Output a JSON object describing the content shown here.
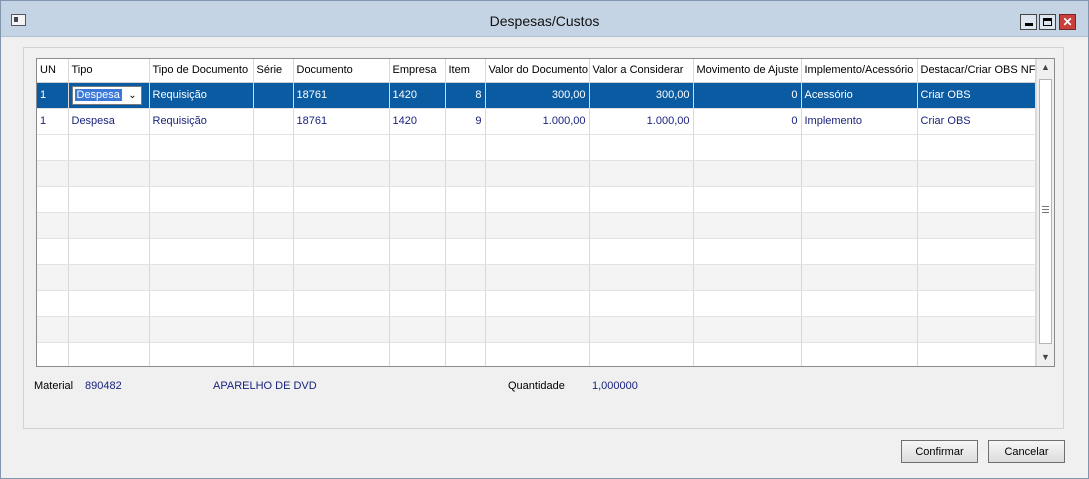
{
  "window": {
    "title": "Despesas/Custos",
    "minimize_icon": "minimize-icon",
    "maximize_icon": "maximize-icon",
    "close_icon": "close-icon",
    "close_glyph": "✕"
  },
  "grid": {
    "columns": [
      "UN",
      "Tipo",
      "Tipo de Documento",
      "Série",
      "Documento",
      "Empresa",
      "Item",
      "Valor do Documento",
      "Valor a Considerar",
      "Movimento de Ajuste",
      "Implemento/Acessório",
      "Destacar/Criar OBS NF"
    ],
    "rows": [
      [
        "1",
        "Despesa",
        "Requisição",
        "",
        "18761",
        "1420",
        "8",
        "300,00",
        "300,00",
        "0",
        "Acessório",
        "Criar OBS"
      ],
      [
        "1",
        "Despesa",
        "Requisição",
        "",
        "18761",
        "1420",
        "9",
        "1.000,00",
        "1.000,00",
        "0",
        "Implemento",
        "Criar OBS"
      ]
    ],
    "selected_row_index": 0,
    "tipo_dropdown_arrow": "chevron-down-icon",
    "scroll_up_glyph": "▲",
    "scroll_down_glyph": "▼"
  },
  "material": {
    "label": "Material",
    "code": "890482",
    "description": "APARELHO DE DVD",
    "quantity_label": "Quantidade",
    "quantity": "1,000000"
  },
  "buttons": {
    "confirm": "Confirmar",
    "cancel": "Cancelar"
  },
  "colors": {
    "selected_row": "#0b5ba3",
    "cell_text": "#1a237e",
    "close_button": "#c9403a"
  }
}
